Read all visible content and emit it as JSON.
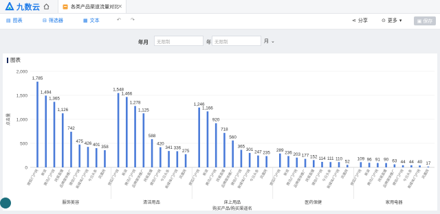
{
  "app": {
    "brand": "九数云",
    "doc_tab": "各类产品渠道流量对比"
  },
  "toolbar": {
    "chart_label": "图表",
    "filter_label": "筛选器",
    "text_label": "文本",
    "share_label": "分享",
    "more_label": "更多",
    "save_label": "保存"
  },
  "filter": {
    "year_month_label": "年月",
    "start_placeholder": "无限制",
    "year_label": "年",
    "end_placeholder": "无限制",
    "month_label": "月"
  },
  "panel": {
    "title": "图表"
  },
  "chart_data": {
    "type": "bar",
    "xlabel": "购买产品/购买渠道名",
    "ylabel": "点击量",
    "ylim": [
      0,
      2000
    ],
    "yticks": [
      "0",
      "500",
      "1,000",
      "1,500",
      "2,000"
    ],
    "groups": [
      {
        "name": "服饰美容",
        "bars": [
          {
            "label": "搜狐/门户网",
            "value": 1785
          },
          {
            "label": "新浪",
            "value": 1494
          },
          {
            "label": "腾讯/门户网",
            "value": 1365
          },
          {
            "label": "网易直播",
            "value": 1126
          },
          {
            "label": "品牌媒体推广",
            "value": 742
          },
          {
            "label": "微信/门户网",
            "value": 475
          },
          {
            "label": "新媒体/门户网",
            "value": 426
          },
          {
            "label": "今日头条",
            "value": 401
          },
          {
            "label": "凤凰网",
            "value": 358
          }
        ]
      },
      {
        "name": "清洁用品",
        "bars": [
          {
            "label": "搜狐/门户网",
            "value": 1548
          },
          {
            "label": "新浪",
            "value": 1466
          },
          {
            "label": "腾讯/门户网",
            "value": 1278
          },
          {
            "label": "品牌媒体推广",
            "value": 1125
          },
          {
            "label": "网易直播",
            "value": 588
          },
          {
            "label": "微信/门户网",
            "value": 420
          },
          {
            "label": "今日头条",
            "value": 341
          },
          {
            "label": "新媒体/门户网",
            "value": 336
          },
          {
            "label": "凤凰网",
            "value": 275
          }
        ]
      },
      {
        "name": "床上用品",
        "bars": [
          {
            "label": "搜狐/门户网",
            "value": 1246
          },
          {
            "label": "新浪",
            "value": 1166
          },
          {
            "label": "腾讯/门户网",
            "value": 920
          },
          {
            "label": "网易直播",
            "value": 718
          },
          {
            "label": "品牌媒体推广",
            "value": 560
          },
          {
            "label": "微信/门户网",
            "value": 365
          },
          {
            "label": "新媒体/门户网",
            "value": 301
          },
          {
            "label": "今日头条",
            "value": 247
          },
          {
            "label": "凤凰网",
            "value": 235
          }
        ]
      },
      {
        "name": "医药保健",
        "bars": [
          {
            "label": "搜狐/门户网",
            "value": 289
          },
          {
            "label": "新浪",
            "value": 236
          },
          {
            "label": "腾讯/门户网",
            "value": 203
          },
          {
            "label": "品牌媒体推广",
            "value": 177
          },
          {
            "label": "网易直播",
            "value": 152
          },
          {
            "label": "微信/门户网",
            "value": 114
          },
          {
            "label": "今日头条",
            "value": 111
          },
          {
            "label": "新媒体/门户网",
            "value": 110
          },
          {
            "label": "凤凰网",
            "value": 52
          }
        ]
      },
      {
        "name": "家用电器",
        "bars": [
          {
            "label": "搜狐/门户网",
            "value": 109
          },
          {
            "label": "新浪",
            "value": 96
          },
          {
            "label": "腾讯/门户网",
            "value": 91
          },
          {
            "label": "网易直播",
            "value": 90
          },
          {
            "label": "品牌媒体推广",
            "value": 63
          },
          {
            "label": "微信/门户网",
            "value": 44
          },
          {
            "label": "今日头条",
            "value": 44
          },
          {
            "label": "新媒体/门户网",
            "value": 40
          },
          {
            "label": "凤凰网",
            "value": 17
          }
        ]
      }
    ],
    "bar_color": "#4a7bd9",
    "grid": true
  }
}
